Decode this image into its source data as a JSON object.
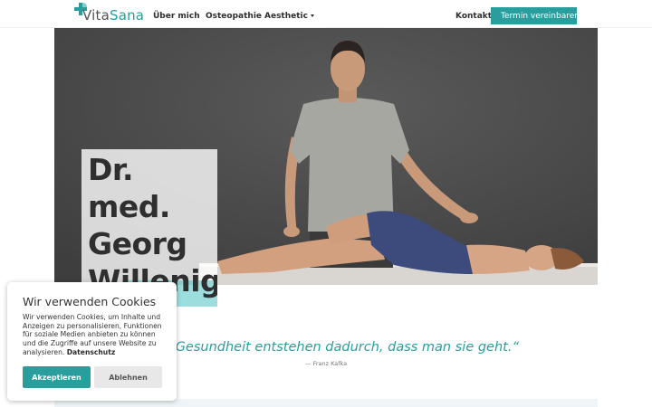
{
  "brand": {
    "name_part1": "Vita",
    "name_part2": "Sana",
    "logo_icon": "cross-leaf-icon",
    "accent_color": "#2a9d9d"
  },
  "nav": {
    "items": [
      {
        "label": "Über mich"
      },
      {
        "label": "Osteopathie"
      },
      {
        "label": "Aesthetic",
        "has_dropdown": true
      }
    ],
    "contact": "Kontakt",
    "cta": {
      "label": "Termin vereinbaren",
      "icon": "phone-icon"
    }
  },
  "hero": {
    "name_lines": [
      "Dr.",
      "med.",
      "Georg",
      "Willenig"
    ]
  },
  "quote": {
    "text": "der Gesundheit entstehen dadurch, dass man sie geht.“",
    "author": "— Franz Kafka"
  },
  "cookie": {
    "title": "Wir verwenden Cookies",
    "text": "Wir verwenden Cookies, um Inhalte und Anzeigen zu personalisieren, Funktionen für soziale Medien anbieten zu können und die Zugriffe auf unsere Website zu analysieren.",
    "link": "Datenschutz",
    "accept": "Akzeptieren",
    "decline": "Ablehnen"
  }
}
